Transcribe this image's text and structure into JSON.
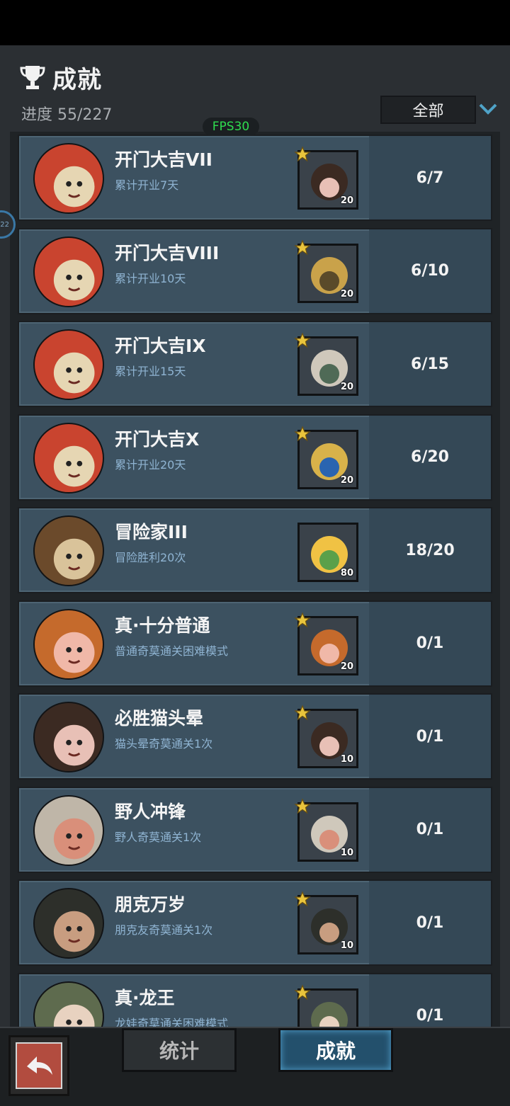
{
  "header": {
    "title": "成就",
    "progress": "进度 55/227",
    "filter_value": "全部",
    "fps": "FPS30",
    "side_badge": "22"
  },
  "achievements": [
    {
      "title": "开门大吉VII",
      "desc": "累计开业7天",
      "reward_qty": "20",
      "count": "6/7",
      "avatar_icon": "lucky-shop-icon",
      "reward_icon": "cat-girl-portrait-icon",
      "starred": true
    },
    {
      "title": "开门大吉VIII",
      "desc": "累计开业10天",
      "reward_qty": "20",
      "count": "6/10",
      "avatar_icon": "lucky-shop-icon",
      "reward_icon": "golden-mask-portrait-icon",
      "starred": true
    },
    {
      "title": "开门大吉IX",
      "desc": "累计开业15天",
      "reward_qty": "20",
      "count": "6/15",
      "avatar_icon": "lucky-shop-icon",
      "reward_icon": "skull-mask-portrait-icon",
      "starred": true
    },
    {
      "title": "开门大吉X",
      "desc": "累计开业20天",
      "reward_qty": "20",
      "count": "6/20",
      "avatar_icon": "lucky-shop-icon",
      "reward_icon": "gold-helmet-portrait-icon",
      "starred": true
    },
    {
      "title": "冒险家III",
      "desc": "冒险胜利20次",
      "reward_qty": "80",
      "count": "18/20",
      "avatar_icon": "adventurers-icon",
      "reward_icon": "golden-carrot-icon",
      "starred": false
    },
    {
      "title": "真·十分普通",
      "desc": "普通奇莫通关困难模式",
      "reward_qty": "20",
      "count": "0/1",
      "avatar_icon": "pumpkin-hat-icon",
      "reward_icon": "pumpkin-hat-portrait-icon",
      "starred": true
    },
    {
      "title": "必胜猫头晕",
      "desc": "猫头晕奇莫通关1次",
      "reward_qty": "10",
      "count": "0/1",
      "avatar_icon": "cat-girl-icon",
      "reward_icon": "cat-girl-portrait-icon",
      "starred": true
    },
    {
      "title": "野人冲锋",
      "desc": "野人奇莫通关1次",
      "reward_qty": "10",
      "count": "0/1",
      "avatar_icon": "savage-skull-icon",
      "reward_icon": "savage-skull-portrait-icon",
      "starred": true
    },
    {
      "title": "朋克万岁",
      "desc": "朋克友奇莫通关1次",
      "reward_qty": "10",
      "count": "0/1",
      "avatar_icon": "punk-goggles-icon",
      "reward_icon": "punk-goggles-portrait-icon",
      "starred": true
    },
    {
      "title": "真·龙王",
      "desc": "龙娃奇莫通关困难模式",
      "reward_qty": "",
      "count": "0/1",
      "avatar_icon": "dragon-kid-icon",
      "reward_icon": "dragon-kid-portrait-icon",
      "starred": true
    }
  ],
  "bottom_nav": {
    "tab_stats": "统计",
    "tab_achievements": "成就"
  },
  "colors": {
    "row_bg": "#3c5160",
    "row_right_bg": "#344856",
    "desc_text": "#8fb4d2",
    "fps_text": "#2fdc4f",
    "active_tab": "#23506c",
    "back_button": "#b24c3f"
  }
}
